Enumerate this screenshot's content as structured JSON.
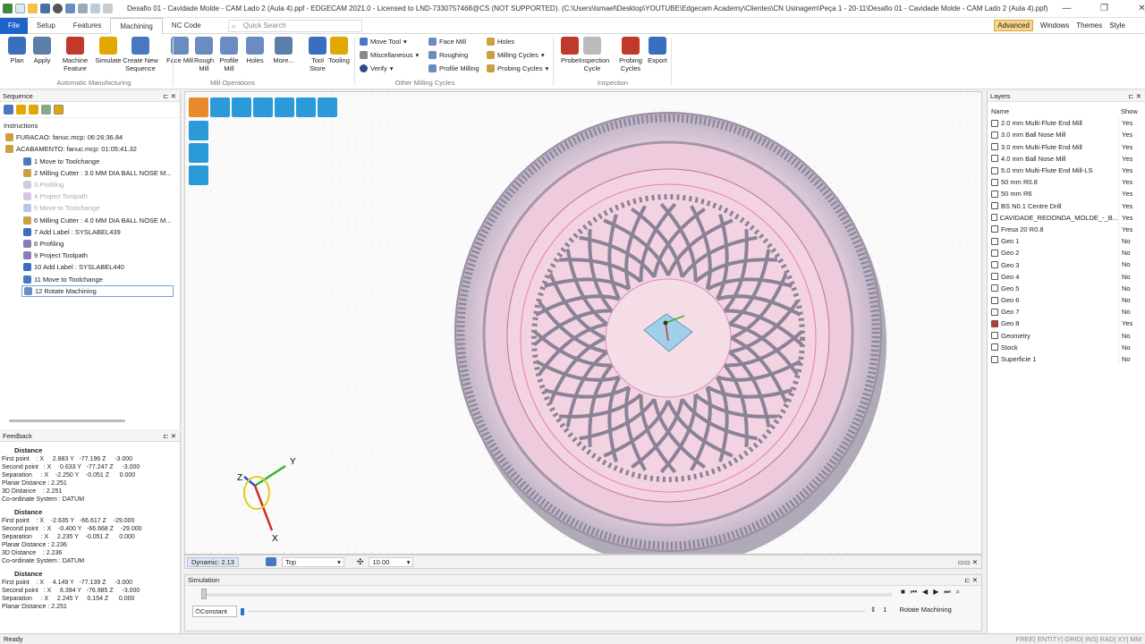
{
  "window": {
    "title": "Desafio 01 - Cavidade Molde - CAM Lado 2 (Aula 4).ppf - EDGECAM 2021.0 - Licensed to LND-7330757468@CS (NOT SUPPORTED). (C:\\Users\\Ismael\\Desktop\\YOUTUBE\\Edgecam Academy\\Clientes\\CN Usinagem\\Peça 1 - 20-11\\Desafio 01 - Cavidade Molde - CAM Lado 2 (Aula 4).ppf)",
    "minimize": "—",
    "maximize": "❐",
    "close": "✕"
  },
  "menu": {
    "tabs": [
      "File",
      "Setup",
      "Features",
      "Machining",
      "NC Code"
    ],
    "active_tab": "Machining",
    "quick_search": "Quick Search",
    "right": {
      "advanced": "Advanced",
      "windows": "Windows",
      "themes": "Themes",
      "style": "Style"
    }
  },
  "ribbon": {
    "buttons": [
      {
        "label": "Plan",
        "color": "#3a6fbf"
      },
      {
        "label": "Apply",
        "color": "#5a7fa8"
      },
      {
        "label": "Machine Feature",
        "color": "#c0392b"
      },
      {
        "label": "Simulate",
        "color": "#e0a800"
      },
      {
        "label": "Create New Sequence",
        "color": "#4a78c0"
      },
      {
        "label": "Face Mill",
        "color": "#6a8cc0"
      },
      {
        "label": "Rough Mill",
        "color": "#6a8cc0"
      },
      {
        "label": "Profile Mill",
        "color": "#6a8cc0"
      },
      {
        "label": "Holes",
        "color": "#6a8cc0"
      },
      {
        "label": "More...",
        "color": "#5a7fa8"
      },
      {
        "label": "Tool Store",
        "color": "#3a6fbf"
      },
      {
        "label": "Tooling",
        "color": "#e0a800"
      },
      {
        "label": "Probe",
        "color": "#c0392b"
      },
      {
        "label": "Inspection Cycle",
        "color": "#bbbbbb"
      },
      {
        "label": "Probing Cycles",
        "color": "#c0392b"
      },
      {
        "label": "Export",
        "color": "#3a6fbf"
      }
    ],
    "small": [
      "Move Tool",
      "Miscellaneous",
      "Verify",
      "Face Mill",
      "Roughing",
      "Profile Milling",
      "Holes",
      "Milling Cycles",
      "Probing Cycles"
    ],
    "groups": [
      "Automatic Manufacturing",
      "Mill Operations",
      "Other Milling Cycles",
      "Inspection"
    ]
  },
  "sequence": {
    "title": "Sequence",
    "instructions_label": "Instructions",
    "items": [
      {
        "text": "FURACAO: fanuc.mcp: 06:26:36.84",
        "dim": false,
        "indent": 1
      },
      {
        "text": "ACABAMENTO: fanuc.mcp: 01:05:41.32",
        "dim": false,
        "indent": 1
      },
      {
        "text": "1 Move to Toolchange",
        "dim": false,
        "indent": 2
      },
      {
        "text": "2 Milling Cutter : 3.0 MM DIA BALL NOSE M...",
        "dim": false,
        "indent": 2
      },
      {
        "text": "3 Profiling",
        "dim": true,
        "indent": 2
      },
      {
        "text": "4 Project Toolpath",
        "dim": true,
        "indent": 2
      },
      {
        "text": "5 Move to Toolchange",
        "dim": true,
        "indent": 2
      },
      {
        "text": "6 Milling Cutter : 4.0 MM DIA BALL NOSE M...",
        "dim": false,
        "indent": 2
      },
      {
        "text": "7 Add Label : SYSLABEL439",
        "dim": false,
        "indent": 2
      },
      {
        "text": "8 Profiling",
        "dim": false,
        "indent": 2
      },
      {
        "text": "9 Project Toolpath",
        "dim": false,
        "indent": 2
      },
      {
        "text": "10 Add Label : SYSLABEL440",
        "dim": false,
        "indent": 2
      },
      {
        "text": "11 Move to Toolchange",
        "dim": false,
        "indent": 2
      },
      {
        "text": "12 Rotate Machining",
        "dim": false,
        "indent": 2
      }
    ]
  },
  "feedback": {
    "title": "Feedback",
    "blocks": [
      {
        "head": "Distance",
        "lines": [
          "First point    : X     2.883 Y   -77.196 Z     -3.000",
          "Second point   : X     0.633 Y   -77.247 Z     -3.000",
          "Separation     : X    -2.250 Y    -0.051 Z      0.000",
          "Planar Distance : 2.251",
          "3D Distance    : 2.251",
          "Co-ordinate System : DATUM"
        ]
      },
      {
        "head": "Distance",
        "lines": [
          "First point    : X    -2.635 Y   -66.617 Z    -29.000",
          "Second point   : X    -0.400 Y   -66.668 Z    -29.000",
          "Separation     : X     2.235 Y    -0.051 Z      0.000",
          "Planar Distance : 2.236",
          "3D Distance    : 2.236",
          "Co-ordinate System : DATUM"
        ]
      },
      {
        "head": "Distance",
        "lines": [
          "First point    : X     4.149 Y   -77.139 Z     -3.000",
          "Second point   : X     6.394 Y   -76.985 Z     -3.000",
          "Separation     : X     2.245 Y     0.154 Z      0.000",
          "Planar Distance : 2.251"
        ]
      }
    ]
  },
  "viewport": {
    "triad": {
      "x": "X",
      "y": "Y",
      "z": "Z"
    },
    "status_label": "Dynamic: 2.13",
    "view": "Top",
    "zoom_value": "10.00"
  },
  "simulation": {
    "title": "Simulation",
    "speed_label": "Constant",
    "counter": "1",
    "current_op": "Rotate Machining"
  },
  "layers": {
    "title": "Layers",
    "col_name": "Name",
    "col_show": "Show",
    "rows": [
      {
        "name": "2.0 mm Multi-Flute End Mill",
        "show": "Yes"
      },
      {
        "name": "3.0 mm Ball Nose Mill",
        "show": "Yes"
      },
      {
        "name": "3.0 mm Multi-Flute End Mill",
        "show": "Yes"
      },
      {
        "name": "4.0 mm Ball Nose Mill",
        "show": "Yes"
      },
      {
        "name": "5.0 mm Multi-Flute End Mill-LS",
        "show": "Yes"
      },
      {
        "name": "50 mm R0.8",
        "show": "Yes"
      },
      {
        "name": "50 mm R6",
        "show": "Yes"
      },
      {
        "name": "BS N0.1 Centre Drill",
        "show": "Yes"
      },
      {
        "name": "CAVIDADE_REDONDA_MOLDE_-_B...",
        "show": "Yes"
      },
      {
        "name": "Fresa 20 R0.8",
        "show": "Yes"
      },
      {
        "name": "Geo 1",
        "show": "No"
      },
      {
        "name": "Geo 2",
        "show": "No"
      },
      {
        "name": "Geo 3",
        "show": "No"
      },
      {
        "name": "Geo 4",
        "show": "No"
      },
      {
        "name": "Geo 5",
        "show": "No"
      },
      {
        "name": "Geo 6",
        "show": "No"
      },
      {
        "name": "Geo 7",
        "show": "No"
      },
      {
        "name": "Geo 8",
        "show": "Yes"
      },
      {
        "name": "Geometry",
        "show": "No"
      },
      {
        "name": "Stock",
        "show": "No"
      },
      {
        "name": "Superficie 1",
        "show": "No"
      }
    ]
  },
  "status": {
    "left": "Ready",
    "right": "FREE| ENTITY| GRID| INS| RAD| XY| MM"
  },
  "colors": {
    "accent": "#1e64c8",
    "toolpath": "#e8559a",
    "part": "#8a8896",
    "active_tab": "#ffffff",
    "advanced": "#f6d58a"
  }
}
